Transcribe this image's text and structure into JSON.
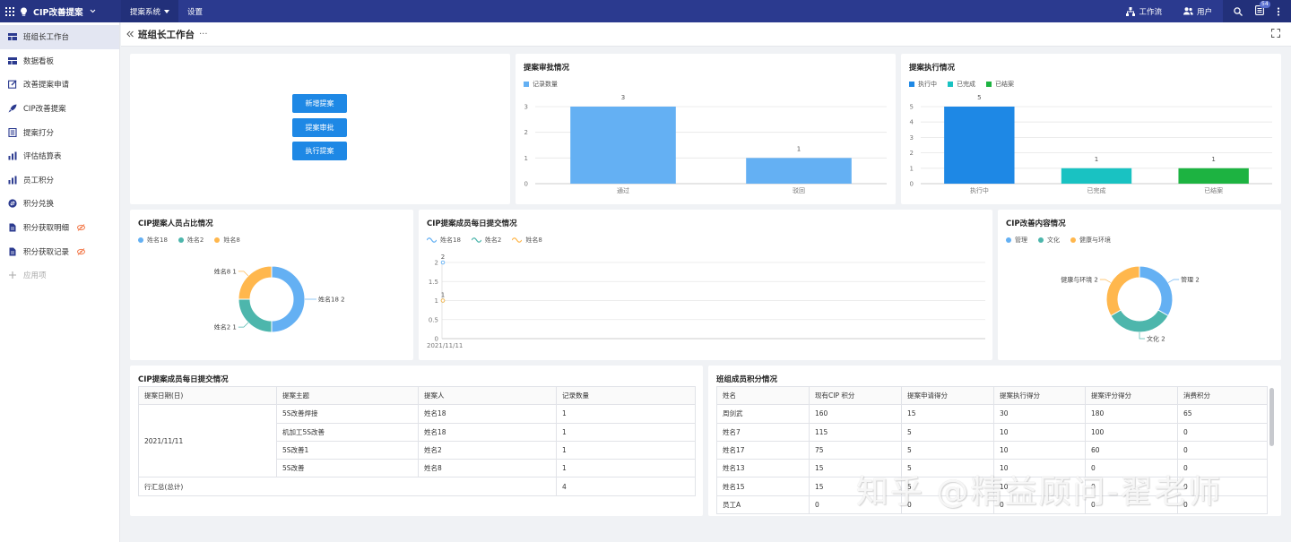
{
  "topbar": {
    "app_name": "CIP改善提案",
    "menu": [
      {
        "label": "提案系统",
        "active": true
      },
      {
        "label": "设置",
        "active": false
      }
    ],
    "workflow_label": "工作流",
    "user_label": "用户",
    "notification_count": "54"
  },
  "sidebar": {
    "items": [
      {
        "label": "班组长工作台",
        "icon": "dashboard-icon",
        "active": true
      },
      {
        "label": "数据看板",
        "icon": "dashboard-icon"
      },
      {
        "label": "改善提案申请",
        "icon": "edit-icon"
      },
      {
        "label": "CIP改善提案",
        "icon": "rocket-icon"
      },
      {
        "label": "提案打分",
        "icon": "document-icon"
      },
      {
        "label": "评估结算表",
        "icon": "bar-chart-icon"
      },
      {
        "label": "员工积分",
        "icon": "bar-chart-icon"
      },
      {
        "label": "积分兑换",
        "icon": "exchange-icon"
      },
      {
        "label": "积分获取明细",
        "icon": "file-icon",
        "badge": "eye-off-icon"
      },
      {
        "label": "积分获取记录",
        "icon": "file-icon",
        "badge": "eye-off-icon"
      },
      {
        "label": "应用项",
        "icon": "plus-icon",
        "muted": true
      }
    ]
  },
  "page": {
    "title": "班组长工作台"
  },
  "actions": {
    "new_proposal": "新增提案",
    "approve_proposal": "提案审批",
    "execute_proposal": "执行提案"
  },
  "approval_chart": {
    "title": "提案审批情况",
    "legend": "记录数量",
    "chart_data": {
      "type": "bar",
      "categories": [
        "通过",
        "驳回"
      ],
      "values": [
        3,
        1
      ],
      "ylim": [
        0,
        3
      ],
      "yticks": [
        "0",
        "1",
        "2",
        "3"
      ],
      "color": "#64b0f3"
    }
  },
  "execution_chart": {
    "title": "提案执行情况",
    "legend": [
      "执行中",
      "已完成",
      "已结案"
    ],
    "chart_data": {
      "type": "bar",
      "categories": [
        "执行中",
        "已完成",
        "已结案"
      ],
      "values": [
        5,
        1,
        1
      ],
      "colors": [
        "#1e88e5",
        "#19c2c2",
        "#1db341"
      ],
      "ylim": [
        0,
        5
      ],
      "yticks": [
        "0",
        "1",
        "2",
        "3",
        "4",
        "5"
      ]
    }
  },
  "member_ratio_chart": {
    "title": "CIP提案人员占比情况",
    "legend": [
      "姓名18",
      "姓名2",
      "姓名8"
    ],
    "chart_data": {
      "type": "pie",
      "labels": [
        "姓名18",
        "姓名2",
        "姓名8"
      ],
      "values": [
        2,
        1,
        1
      ],
      "colors": [
        "#64b0f3",
        "#4db6ac",
        "#ffb74d"
      ],
      "slice_labels": [
        "姓名18  2",
        "姓名2  1",
        "姓名8  1"
      ]
    }
  },
  "daily_chart": {
    "title": "CIP提案成员每日提交情况",
    "legend": [
      "姓名18",
      "姓名2",
      "姓名8"
    ],
    "chart_data": {
      "type": "line",
      "x": [
        "2021/11/11"
      ],
      "series": [
        {
          "name": "姓名18",
          "values": [
            2
          ],
          "color": "#64b0f3"
        },
        {
          "name": "姓名2",
          "values": [
            1
          ],
          "color": "#4db6ac"
        },
        {
          "name": "姓名8",
          "values": [
            1
          ],
          "color": "#ffb74d"
        }
      ],
      "ylim": [
        0,
        2
      ],
      "yticks": [
        "0",
        "0.5",
        "1",
        "1.5",
        "2"
      ],
      "point_labels": [
        "2",
        "1"
      ]
    }
  },
  "content_chart": {
    "title": "CIP改善内容情况",
    "legend": [
      "管理",
      "文化",
      "健康与环境"
    ],
    "chart_data": {
      "type": "pie",
      "labels": [
        "管理",
        "文化",
        "健康与环境"
      ],
      "values": [
        2,
        2,
        2
      ],
      "colors": [
        "#64b0f3",
        "#4db6ac",
        "#ffb74d"
      ],
      "slice_labels": [
        "管理  2",
        "文化  2",
        "健康与环境  2"
      ]
    }
  },
  "daily_table": {
    "title": "CIP提案成员每日提交情况",
    "headers": [
      "提案日期(日)",
      "提案主题",
      "提案人",
      "记录数量"
    ],
    "date": "2021/11/11",
    "rows": [
      {
        "topic": "5S改善焊接",
        "person": "姓名18",
        "count": "1"
      },
      {
        "topic": "机加工5S改善",
        "person": "姓名18",
        "count": "1"
      },
      {
        "topic": "5S改善1",
        "person": "姓名2",
        "count": "1"
      },
      {
        "topic": "5S改善",
        "person": "姓名8",
        "count": "1"
      }
    ],
    "total_label": "行汇总(总计)",
    "total_value": "4"
  },
  "points_table": {
    "title": "班组成员积分情况",
    "headers": [
      "姓名",
      "现有CIP 积分",
      "提案申请得分",
      "提案执行得分",
      "提案评分得分",
      "消费积分"
    ],
    "rows": [
      [
        "周剑武",
        "160",
        "15",
        "30",
        "180",
        "65"
      ],
      [
        "姓名7",
        "115",
        "5",
        "10",
        "100",
        "0"
      ],
      [
        "姓名17",
        "75",
        "5",
        "10",
        "60",
        "0"
      ],
      [
        "姓名13",
        "15",
        "5",
        "10",
        "0",
        "0"
      ],
      [
        "姓名15",
        "15",
        "5",
        "10",
        "0",
        "0"
      ],
      [
        "员工A",
        "0",
        "0",
        "0",
        "0",
        "0"
      ]
    ]
  },
  "watermark": "知乎 @精益顾问-翟老师"
}
